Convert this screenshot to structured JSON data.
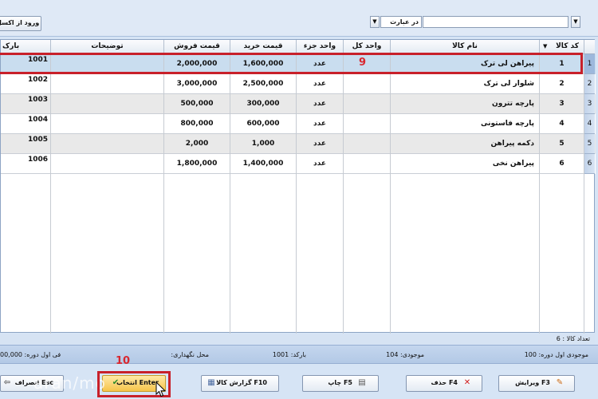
{
  "toolbar": {
    "import_label": "ورود از اکسل",
    "search_mode": "در عبارت",
    "search_value": ""
  },
  "grid": {
    "columns": {
      "code": "کد کالا",
      "name": "نام کالا",
      "unit_whole": "واحد کل",
      "unit_part": "واحد جزء",
      "buy_price": "قیمت خرید",
      "sell_price": "قیمت فروش",
      "desc": "توضیحات",
      "barcode": "بارک"
    },
    "rows": [
      {
        "code": "1",
        "name": "پیراهن لی ترک",
        "unit_part": "عدد",
        "buy": "1,600,000",
        "sell": "2,000,000",
        "barcode": "1001",
        "hdr": "1"
      },
      {
        "code": "2",
        "name": "شلوار لی ترک",
        "unit_part": "عدد",
        "buy": "2,500,000",
        "sell": "3,000,000",
        "barcode": "1002",
        "hdr": "2"
      },
      {
        "code": "3",
        "name": "پارچه تترون",
        "unit_part": "عدد",
        "buy": "300,000",
        "sell": "500,000",
        "barcode": "1003",
        "hdr": "3"
      },
      {
        "code": "4",
        "name": "پارچه فاستونی",
        "unit_part": "عدد",
        "buy": "600,000",
        "sell": "800,000",
        "barcode": "1004",
        "hdr": "4"
      },
      {
        "code": "5",
        "name": "دکمه پیراهن",
        "unit_part": "عدد",
        "buy": "1,000",
        "sell": "2,000",
        "barcode": "1005",
        "hdr": "5"
      },
      {
        "code": "6",
        "name": "پیراهن نخی",
        "unit_part": "عدد",
        "buy": "1,400,000",
        "sell": "1,800,000",
        "barcode": "1006",
        "hdr": "6"
      }
    ]
  },
  "annotations": {
    "step9": "9",
    "step10": "10"
  },
  "count_label": "تعداد کالا : 6",
  "stock": {
    "opening": "موجودی اول دوره: 100",
    "current": "موجودی: 104",
    "barcode": "بارکد: 1001",
    "location": "محل نگهداری:",
    "value": "فی اول دوره: 00,000"
  },
  "footer": {
    "edit": "ویرایش F3",
    "delete": "حذف F4",
    "print": "چاپ F5",
    "report": "گزارش کالا F10",
    "select": "انتخاب Enter",
    "cancel": "انصراف Esc"
  },
  "watermark": "aran/mo"
}
